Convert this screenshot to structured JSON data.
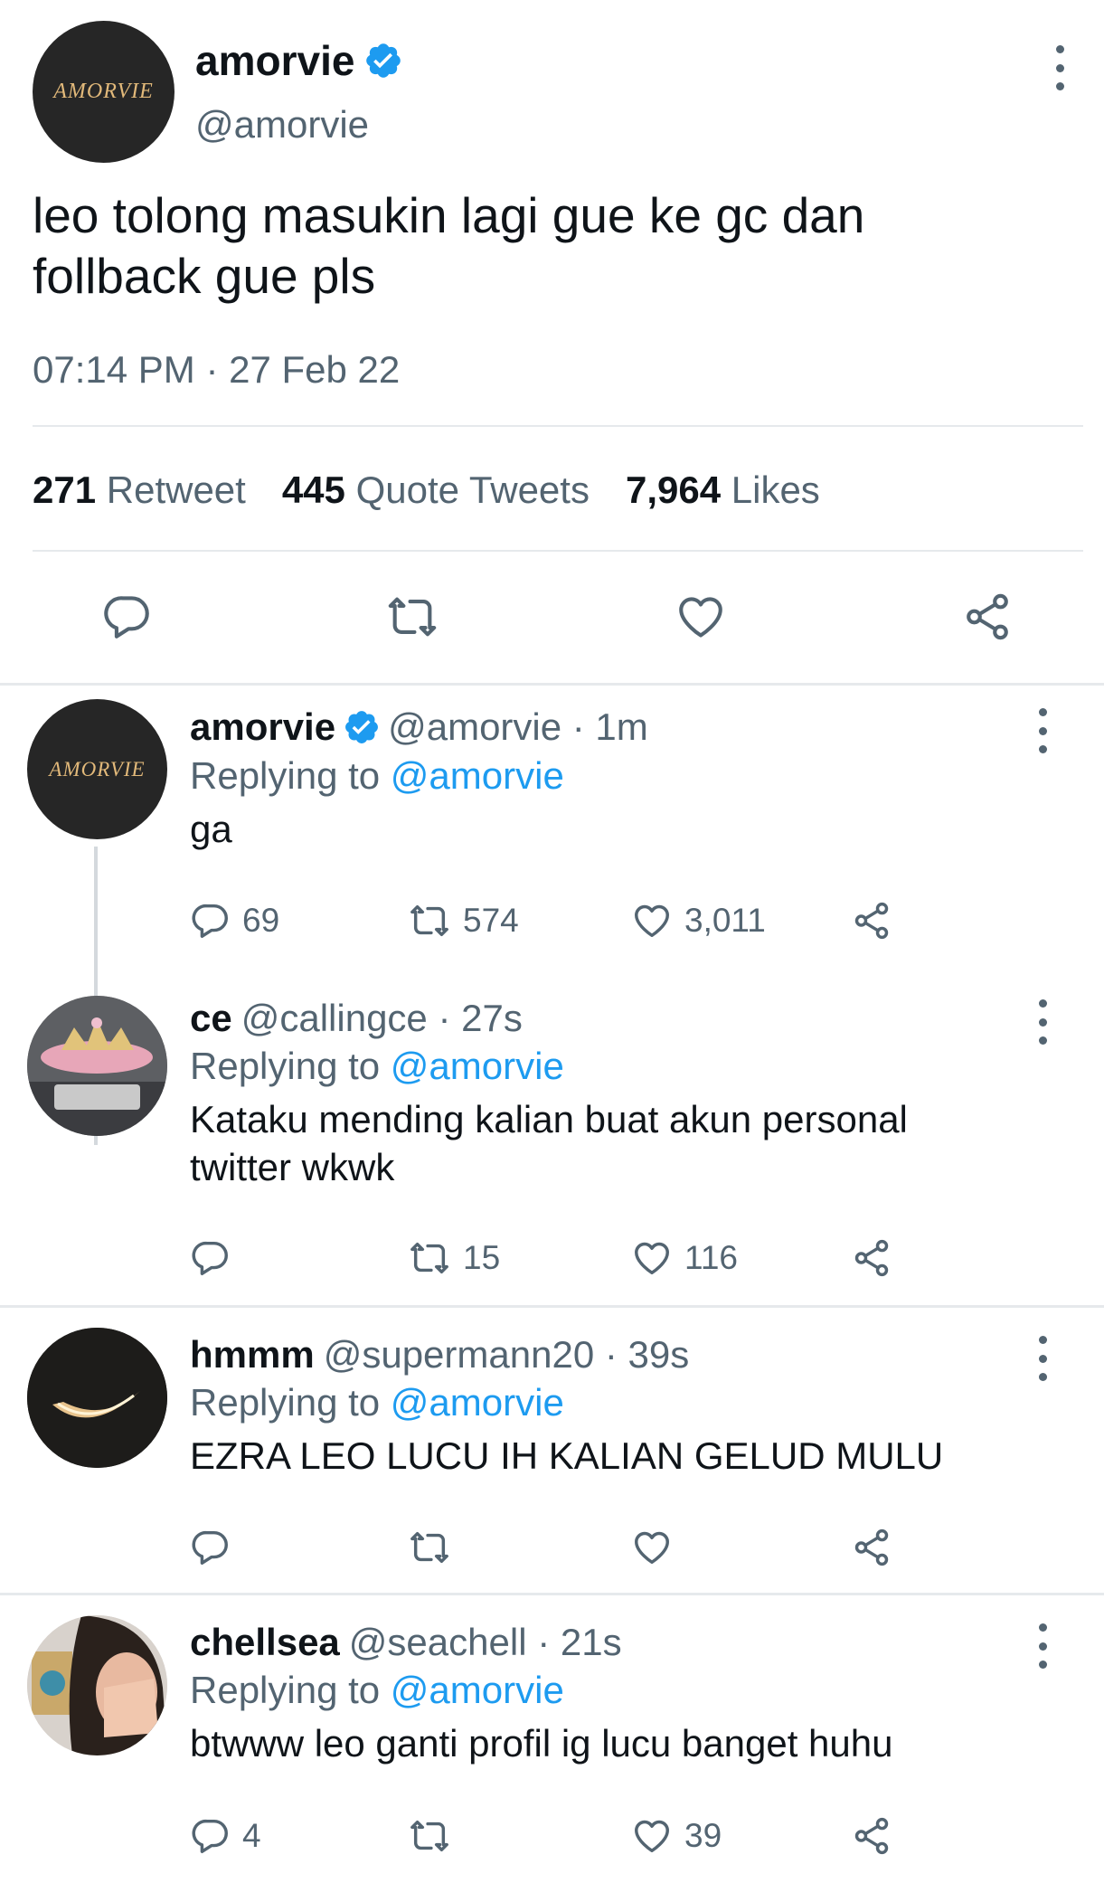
{
  "main_tweet": {
    "avatar_text": "AMORVIE",
    "display_name": "amorvie",
    "handle": "@amorvie",
    "text_line1": "leo tolong masukin lagi gue ke gc dan",
    "text_line2": "follback gue pls",
    "timestamp": "07:14 PM · 27 Feb 22",
    "stats": {
      "retweets_count": "271",
      "retweets_label": "Retweet",
      "quotes_count": "445",
      "quotes_label": "Quote Tweets",
      "likes_count": "7,964",
      "likes_label": "Likes"
    },
    "actions": [
      "reply-icon",
      "retweet-icon",
      "like-icon",
      "share-icon"
    ]
  },
  "replies": [
    {
      "avatar_text": "AMORVIE",
      "avatar_icon": "avatar-logo",
      "name": "amorvie",
      "verified": true,
      "handle_time": "@amorvie · 1m",
      "replying_label": "Replying to",
      "replying_handle": "@amorvie",
      "text": "ga",
      "replies": "69",
      "retweets": "574",
      "likes": "3,011"
    },
    {
      "avatar_icon": "avatar-tiara-photo",
      "name": "ce",
      "handle_time": "@callingce · 27s",
      "replying_label": "Replying to",
      "replying_handle": "@amorvie",
      "text_line1": "Kataku mending kalian buat akun personal",
      "text_line2": "twitter wkwk",
      "replies": "",
      "retweets": "15",
      "likes": "116"
    },
    {
      "avatar_icon": "avatar-moon-photo",
      "name": "hmmm",
      "handle_time": "@supermann20 · 39s",
      "replying_label": "Replying to",
      "replying_handle": "@amorvie",
      "text": "EZRA LEO LUCU IH KALIAN GELUD MULU",
      "replies": "",
      "retweets": "",
      "likes": ""
    },
    {
      "avatar_icon": "avatar-person-photo",
      "name": "chellsea",
      "handle_time": "@seachell · 21s",
      "replying_label": "Replying to",
      "replying_handle": "@amorvie",
      "text": "btwww leo ganti profil ig lucu banget huhu",
      "replies": "4",
      "retweets": "",
      "likes": "39"
    }
  ],
  "colors": {
    "accent": "#1d9bf0",
    "text": "#0f1419",
    "secondary": "#536471",
    "divider": "#e6e9ec"
  }
}
